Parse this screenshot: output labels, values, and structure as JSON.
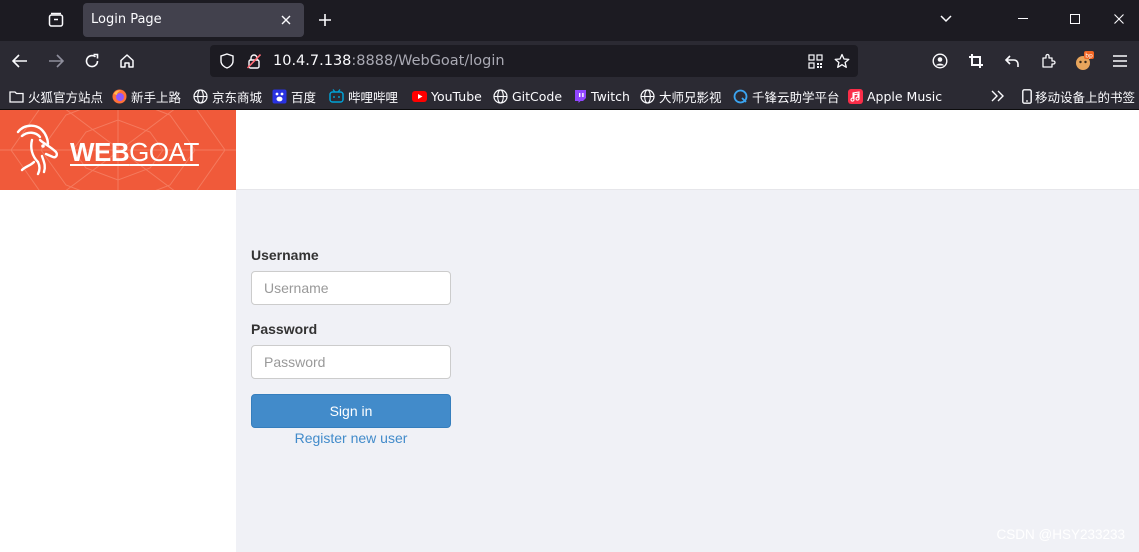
{
  "browser": {
    "tab": {
      "title": "Login Page"
    },
    "url": {
      "host": "10.4.7.138",
      "rest": ":8888/WebGoat/login"
    },
    "bookmarks": [
      {
        "label": "火狐官方站点",
        "icon": "folder-icon"
      },
      {
        "label": "新手上路",
        "icon": "firefox-icon"
      },
      {
        "label": "京东商城",
        "icon": "globe-icon"
      },
      {
        "label": "百度",
        "icon": "baidu-icon"
      },
      {
        "label": "哔哩哔哩",
        "icon": "bilibili-icon"
      },
      {
        "label": "YouTube",
        "icon": "youtube-icon"
      },
      {
        "label": "GitCode",
        "icon": "globe-icon"
      },
      {
        "label": "Twitch",
        "icon": "twitch-icon"
      },
      {
        "label": "大师兄影视",
        "icon": "globe-icon"
      },
      {
        "label": "千锋云助学平台",
        "icon": "qianfeng-icon"
      },
      {
        "label": "Apple Music",
        "icon": "apple-music-icon"
      }
    ],
    "mobile_bookmarks": "移动设备上的书签"
  },
  "brand": {
    "bold": "WEB",
    "thin": "GOAT"
  },
  "login": {
    "username_label": "Username",
    "username_placeholder": "Username",
    "password_label": "Password",
    "password_placeholder": "Password",
    "signin_label": "Sign in",
    "register_label": "Register new user"
  },
  "watermark": "CSDN @HSY233233",
  "colors": {
    "brand": "#f05a3a",
    "primary": "#428bca",
    "main_bg": "#f0f1f6"
  }
}
